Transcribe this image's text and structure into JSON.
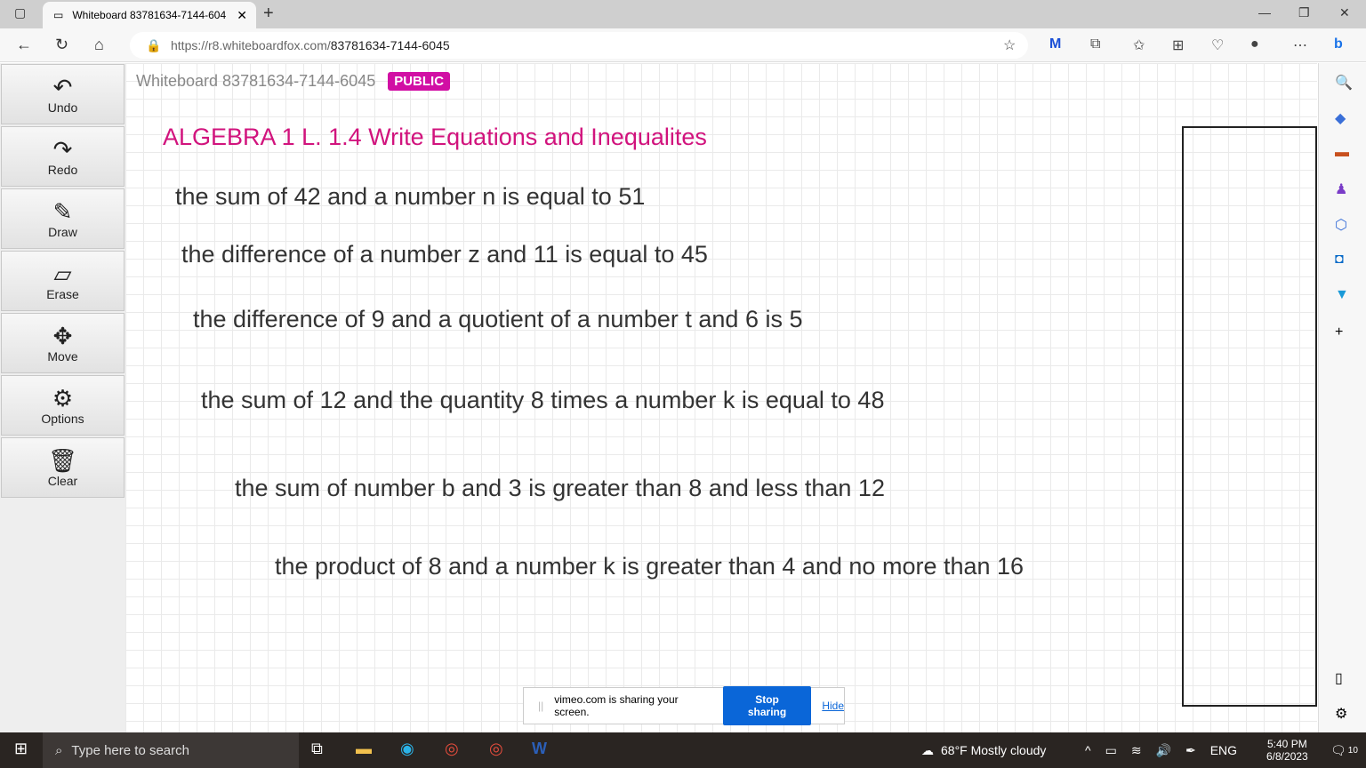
{
  "browser": {
    "tab_title": "Whiteboard 83781634-7144-604",
    "url_host": "https://r8.whiteboardfox.com/",
    "url_path": "83781634-7144-6045"
  },
  "tools": [
    {
      "label": "Undo",
      "icon": "↶"
    },
    {
      "label": "Redo",
      "icon": "↷"
    },
    {
      "label": "Draw",
      "icon": "✎"
    },
    {
      "label": "Erase",
      "icon": "▱"
    },
    {
      "label": "Move",
      "icon": "✥"
    },
    {
      "label": "Options",
      "icon": "⚙"
    },
    {
      "label": "Clear",
      "icon": "🗑"
    }
  ],
  "board": {
    "name": "Whiteboard 83781634-7144-6045",
    "badge": "PUBLIC",
    "title": "ALGEBRA 1 L. 1.4 Write Equations and Inequalites",
    "lines": [
      "the sum of 42 and a number n is equal to 51",
      "the difference of a number z and 11 is equal to 45",
      "the difference of 9 and a quotient of a number t and 6 is 5",
      "the sum of 12 and the quantity 8 times a number k is equal to 48",
      "the sum of number b and 3 is greater than 8 and less than 12",
      "the product of 8 and a number k is greater than 4 and no more than 16"
    ]
  },
  "share": {
    "text": "vimeo.com is sharing your screen.",
    "stop": "Stop sharing",
    "hide": "Hide"
  },
  "taskbar": {
    "search": "Type here to search",
    "weather": "68°F Mostly cloudy",
    "lang": "ENG",
    "time": "5:40 PM",
    "date": "6/8/2023",
    "notifications": "10"
  }
}
